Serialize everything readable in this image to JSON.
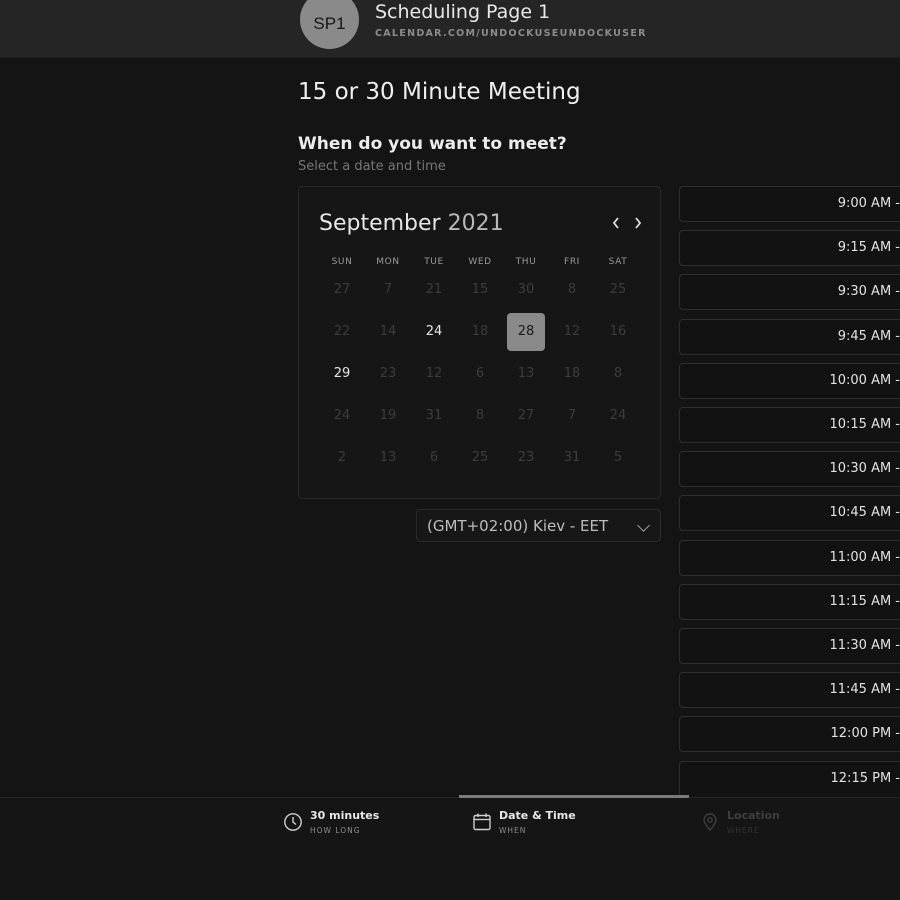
{
  "header": {
    "avatar_initials": "SP1",
    "title": "Scheduling Page 1",
    "url": "CALENDAR.COM/UNDOCKUSEUNDOCKUSER"
  },
  "main": {
    "meeting_title": "15 or 30 Minute Meeting",
    "question": "When do you want to meet?",
    "subtitle": "Select a date and time"
  },
  "calendar": {
    "month": "September",
    "year": "2021",
    "prev_icon": "chevron-left-icon",
    "next_icon": "chevron-right-icon",
    "weekdays": [
      "SUN",
      "MON",
      "TUE",
      "WED",
      "THU",
      "FRI",
      "SAT"
    ],
    "weeks": [
      [
        {
          "d": "27",
          "s": "off"
        },
        {
          "d": "7",
          "s": "off"
        },
        {
          "d": "21",
          "s": "off"
        },
        {
          "d": "15",
          "s": "off"
        },
        {
          "d": "30",
          "s": "off"
        },
        {
          "d": "8",
          "s": "off"
        },
        {
          "d": "25",
          "s": "off"
        }
      ],
      [
        {
          "d": "22",
          "s": "off"
        },
        {
          "d": "14",
          "s": "off"
        },
        {
          "d": "24",
          "s": "avail"
        },
        {
          "d": "18",
          "s": "off"
        },
        {
          "d": "28",
          "s": "selected"
        },
        {
          "d": "12",
          "s": "off"
        },
        {
          "d": "16",
          "s": "off"
        }
      ],
      [
        {
          "d": "29",
          "s": "avail"
        },
        {
          "d": "23",
          "s": "off"
        },
        {
          "d": "12",
          "s": "off"
        },
        {
          "d": "6",
          "s": "off"
        },
        {
          "d": "13",
          "s": "off"
        },
        {
          "d": "18",
          "s": "off"
        },
        {
          "d": "8",
          "s": "off"
        }
      ],
      [
        {
          "d": "24",
          "s": "off"
        },
        {
          "d": "19",
          "s": "off"
        },
        {
          "d": "31",
          "s": "off"
        },
        {
          "d": "8",
          "s": "off"
        },
        {
          "d": "27",
          "s": "off"
        },
        {
          "d": "7",
          "s": "off"
        },
        {
          "d": "24",
          "s": "off"
        }
      ],
      [
        {
          "d": "2",
          "s": "off"
        },
        {
          "d": "13",
          "s": "off"
        },
        {
          "d": "6",
          "s": "off"
        },
        {
          "d": "25",
          "s": "off"
        },
        {
          "d": "23",
          "s": "off"
        },
        {
          "d": "31",
          "s": "off"
        },
        {
          "d": "5",
          "s": "off"
        }
      ]
    ]
  },
  "timezone": {
    "value": "(GMT+02:00) Kiev - EET",
    "icon": "chevron-down-icon"
  },
  "slots": [
    "9:00 AM -",
    "9:15 AM -",
    "9:30 AM -",
    "9:45 AM -",
    "10:00 AM -",
    "10:15 AM -",
    "10:30 AM -",
    "10:45 AM -",
    "11:00 AM -",
    "11:15 AM -",
    "11:30 AM -",
    "11:45 AM -",
    "12:00 PM -",
    "12:15 PM -"
  ],
  "footer": {
    "steps": [
      {
        "title": "30 minutes",
        "sub": "HOW LONG",
        "icon": "clock-icon",
        "state": "done"
      },
      {
        "title": "Date & Time",
        "sub": "WHEN",
        "icon": "calendar-icon",
        "state": "active"
      },
      {
        "title": "Location",
        "sub": "WHERE",
        "icon": "map-pin-icon",
        "state": "pending"
      }
    ]
  },
  "colors": {
    "background": "#141414",
    "header": "#252525",
    "selected_day": "#8a8a8a",
    "text": "#e6e6e6",
    "muted": "#777777"
  }
}
